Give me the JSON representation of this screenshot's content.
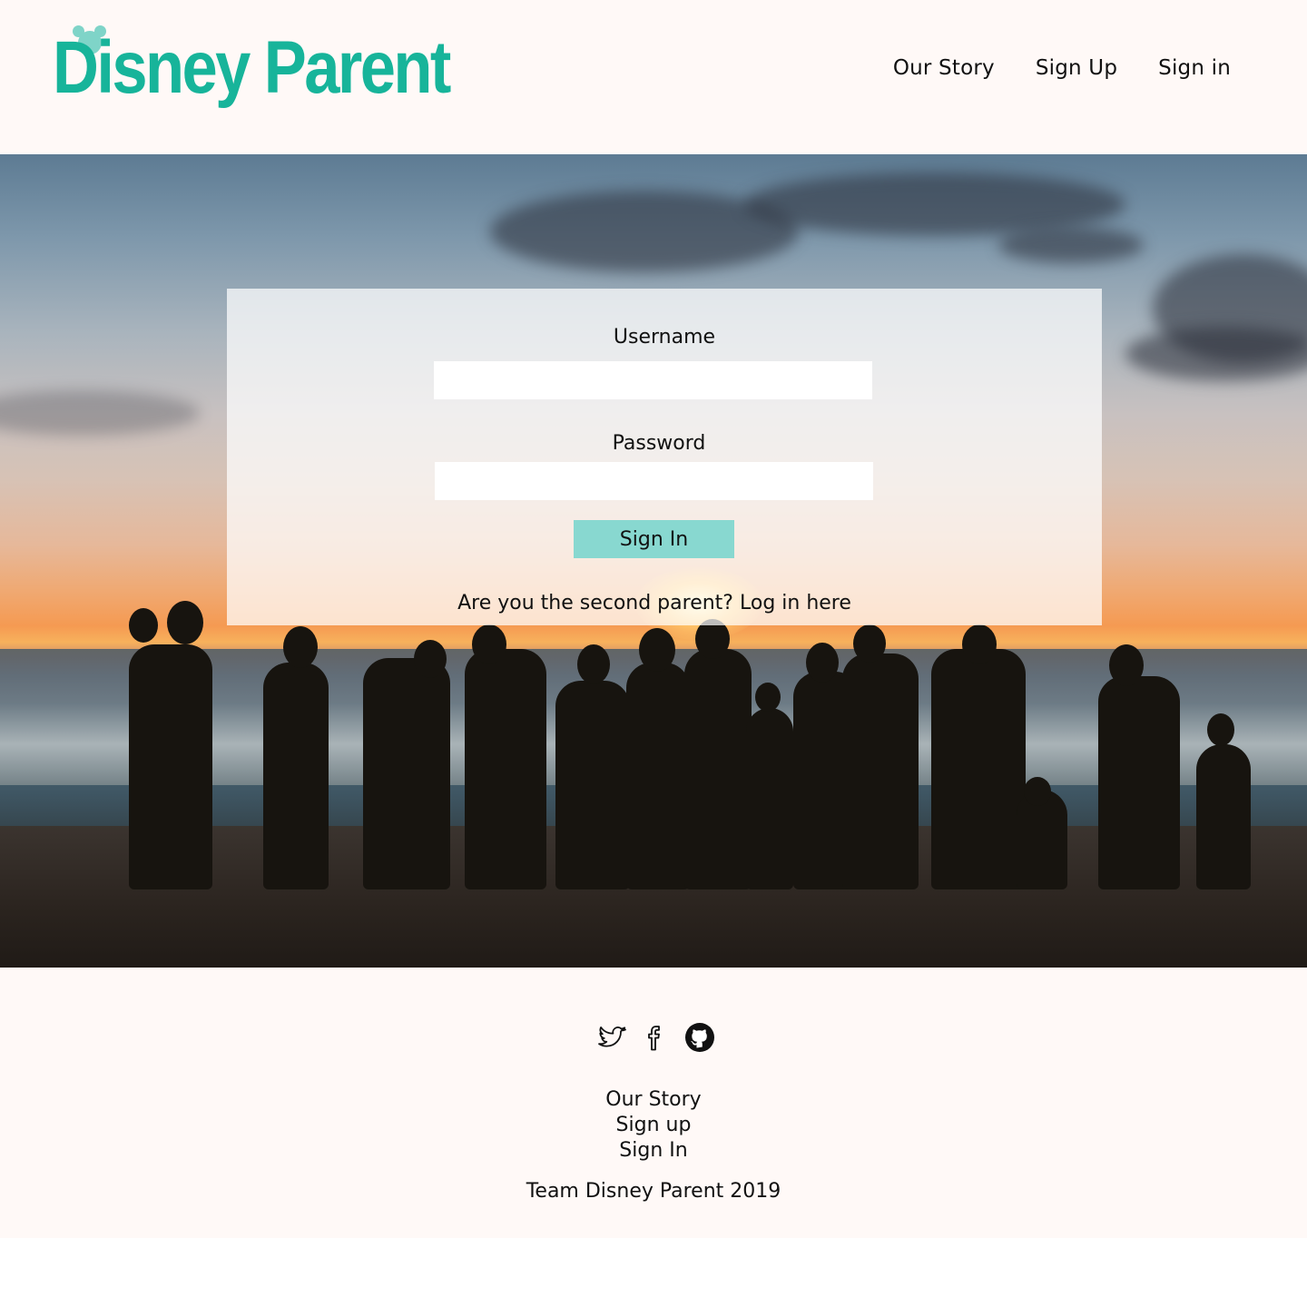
{
  "header": {
    "logo_text": "Disney Parent",
    "nav": [
      "Our Story",
      "Sign Up",
      "Sign in"
    ]
  },
  "login": {
    "username_label": "Username",
    "username_value": "",
    "password_label": "Password",
    "password_value": "",
    "signin_label": "Sign In",
    "second_parent_prefix": "Are you the second parent?",
    "second_parent_link": "Log in here"
  },
  "footer": {
    "social_icons": [
      "twitter-icon",
      "facebook-icon",
      "github-icon"
    ],
    "links": [
      "Our Story",
      "Sign up",
      "Sign In"
    ],
    "copyright": "Team Disney Parent 2019"
  },
  "colors": {
    "brand": "#17b49a",
    "accent": "#88d8d0",
    "header_bg": "#fff9f7"
  }
}
